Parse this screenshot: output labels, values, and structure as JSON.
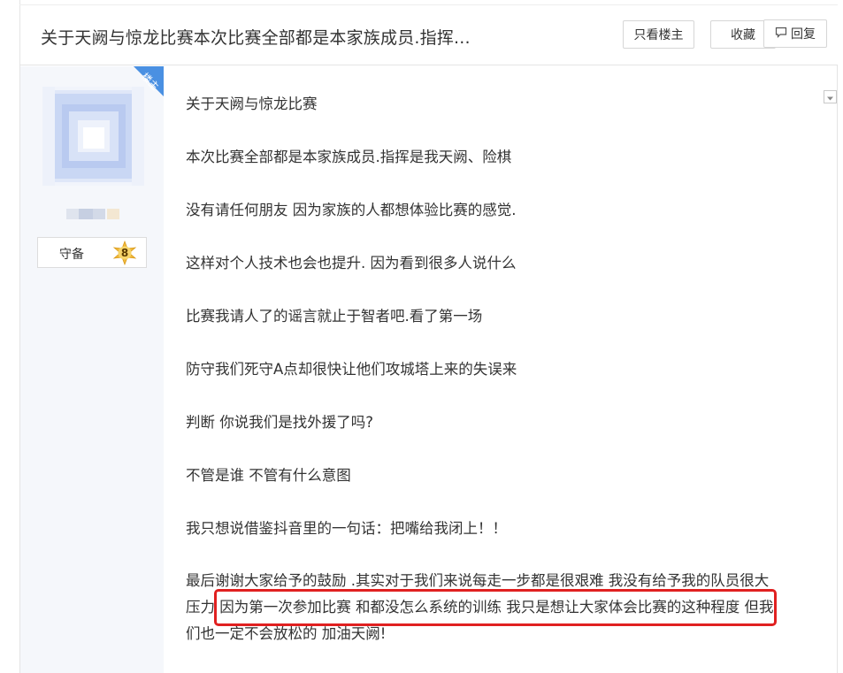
{
  "thread": {
    "title": "关于天阙与惊龙比赛本次比赛全部都是本家族成员.指挥...",
    "only_op_label": "只看楼主",
    "favorite_label": "收藏",
    "reply_label": "回复"
  },
  "author": {
    "badge": "楼主",
    "level_name": "守备",
    "level_number": "8"
  },
  "post": {
    "lines": [
      "关于天阙与惊龙比赛",
      "本次比赛全部都是本家族成员.指挥是我天阙、险棋",
      "没有请任何朋友 因为家族的人都想体验比赛的感觉.",
      "这样对个人技术也会也提升. 因为看到很多人说什么",
      "比赛我请人了的谣言就止于智者吧.看了第一场",
      "防守我们死守A点却很快让他们攻城塔上来的失误来",
      "判断 你说我们是找外援了吗?",
      "不管是谁 不管有什么意图",
      "我只想说借鉴抖音里的一句话：把嘴给我闭上！！"
    ],
    "last_paragraph": [
      "最后谢谢大家给予的鼓励 .其实对于我们来说每走一步都是很艰难 我没有给予我的队员很大",
      "压力 因为第一次参加比赛 和都没怎么系统的训练 我只是想让大家体会比赛的这种程度 但我",
      "们也一定不会放松的 加油天阙!"
    ]
  },
  "colors": {
    "highlight": "#e02020",
    "badge": "#4a90e2",
    "sidebar_bg": "#f5f7fb"
  }
}
